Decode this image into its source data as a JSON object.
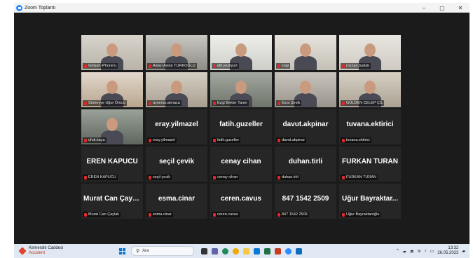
{
  "window": {
    "title": "Zoom Toplantı",
    "minimize": "–",
    "maximize": "▢",
    "close": "✕"
  },
  "tiles": [
    {
      "name": "Gülşah iPhone'u",
      "center": "",
      "video": "v1",
      "active": false
    },
    {
      "name": "Aslan Aslan TURKOĞLU",
      "center": "",
      "video": "v2",
      "active": true
    },
    {
      "name": "elif.yesilyurt",
      "center": "",
      "video": "v3",
      "active": false
    },
    {
      "name": "sngi",
      "center": "",
      "video": "v4",
      "active": false
    },
    {
      "name": "rozzan.budak",
      "center": "",
      "video": "v5",
      "active": false
    },
    {
      "name": "Sümeyye Uğur Örücü",
      "center": "",
      "video": "v6",
      "active": false
    },
    {
      "name": "aysenur.atmaca",
      "center": "",
      "video": "v7",
      "active": false
    },
    {
      "name": "Ezgi Bekler Taner",
      "center": "",
      "video": "v8",
      "active": false
    },
    {
      "name": "Esra Şevik",
      "center": "",
      "video": "v9",
      "active": false
    },
    {
      "name": "GÜLDEN CELEP ÇİL",
      "center": "",
      "video": "v10",
      "active": false
    },
    {
      "name": "ufuk.kaya",
      "center": "",
      "video": "v11",
      "active": false
    },
    {
      "name": "eray.yilmazel",
      "center": "eray.yilmazel",
      "video": "",
      "active": false
    },
    {
      "name": "fatih.guzeller",
      "center": "fatih.guzeller",
      "video": "",
      "active": false
    },
    {
      "name": "davut.akpinar",
      "center": "davut.akpinar",
      "video": "",
      "active": false
    },
    {
      "name": "tuvana.ektirici",
      "center": "tuvana.ektirici",
      "video": "",
      "active": false
    },
    {
      "name": "EREN KAPUCU",
      "center": "EREN KAPUCU",
      "video": "",
      "active": false
    },
    {
      "name": "seçil çevik",
      "center": "seçil çevik",
      "video": "",
      "active": false
    },
    {
      "name": "cenay cihan",
      "center": "cenay cihan",
      "video": "",
      "active": false
    },
    {
      "name": "duhan.tirli",
      "center": "duhan.tirli",
      "video": "",
      "active": false
    },
    {
      "name": "FURKAN TURAN",
      "center": "FURKAN TURAN",
      "video": "",
      "active": false
    },
    {
      "name": "Murat Can Çaylak",
      "center": "Murat Can Çaylak",
      "video": "",
      "active": false
    },
    {
      "name": "esma.cinar",
      "center": "esma.cinar",
      "video": "",
      "active": false
    },
    {
      "name": "ceren.cavus",
      "center": "ceren.cavus",
      "video": "",
      "active": false
    },
    {
      "name": "847 1542 2509",
      "center": "847 1542 2509",
      "video": "",
      "active": false
    },
    {
      "name": "Uğur Bayraktaroğlu",
      "center": "Uğur Bayraktar...",
      "video": "",
      "active": false
    }
  ],
  "taskbar": {
    "weather_title": "Kemeraltı Caddesi",
    "weather_sub": "Accident",
    "search_placeholder": "Ara",
    "time": "13:32",
    "date": "26.05.2023"
  }
}
